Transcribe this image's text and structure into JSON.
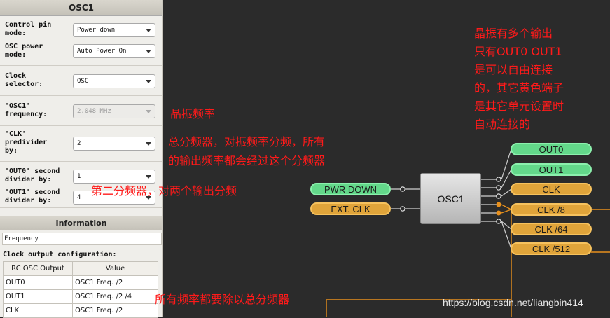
{
  "panel": {
    "title": "OSC1",
    "rows": [
      {
        "label": "Control pin\nmode:",
        "value": "Power down",
        "disabled": false
      },
      {
        "label": "OSC power\nmode:",
        "value": "Auto Power On",
        "disabled": false
      },
      {
        "label": "Clock\nselector:",
        "value": "OSC",
        "disabled": false
      },
      {
        "label": "'OSC1'\nfrequency:",
        "value": "2.048 MHz",
        "disabled": true
      },
      {
        "label": "'CLK'\npredivider\nby:",
        "value": "2",
        "disabled": false
      },
      {
        "label": "'OUT0' second\ndivider by:",
        "value": "1",
        "disabled": false
      },
      {
        "label": "'OUT1' second\ndivider by:",
        "value": "4",
        "disabled": false
      }
    ],
    "information_title": "Information",
    "frequency_label": "Frequency",
    "config_title": "Clock output configuration:",
    "table": {
      "headers": [
        "RC OSC Output",
        "Value"
      ],
      "rows": [
        [
          "OUT0",
          "OSC1 Freq. /2"
        ],
        [
          "OUT1",
          "OSC1 Freq. /2 /4"
        ],
        [
          "CLK",
          "OSC1 Freq. /2"
        ]
      ]
    }
  },
  "annotations": {
    "top_right": [
      "晶振有多个输出",
      "只有OUT0 OUT1",
      "是可以自由连接",
      "的，其它黄色端子",
      "是其它单元设置时",
      "自动连接的"
    ],
    "freq": "晶振频率",
    "predivider": [
      "总分频器，对振频率分频，所有",
      "的输出频率都会经过这个分频器"
    ],
    "second": "第二分频器，对两个输出分频",
    "bottom": "所有频率都要除以总分频器"
  },
  "diagram": {
    "block_label": "OSC1",
    "inputs": [
      "PWR DOWN",
      "EXT. CLK"
    ],
    "outputs": [
      "OUT0",
      "OUT1",
      "CLK",
      "CLK /8",
      "CLK /64",
      "CLK /512"
    ]
  },
  "colors": {
    "green_pin": "#63d88a",
    "orange_pin": "#e0a43a",
    "wire": "#e8901c",
    "annotation": "#ff1a1a"
  },
  "watermark": "https://blog.csdn.net/liangbin414"
}
